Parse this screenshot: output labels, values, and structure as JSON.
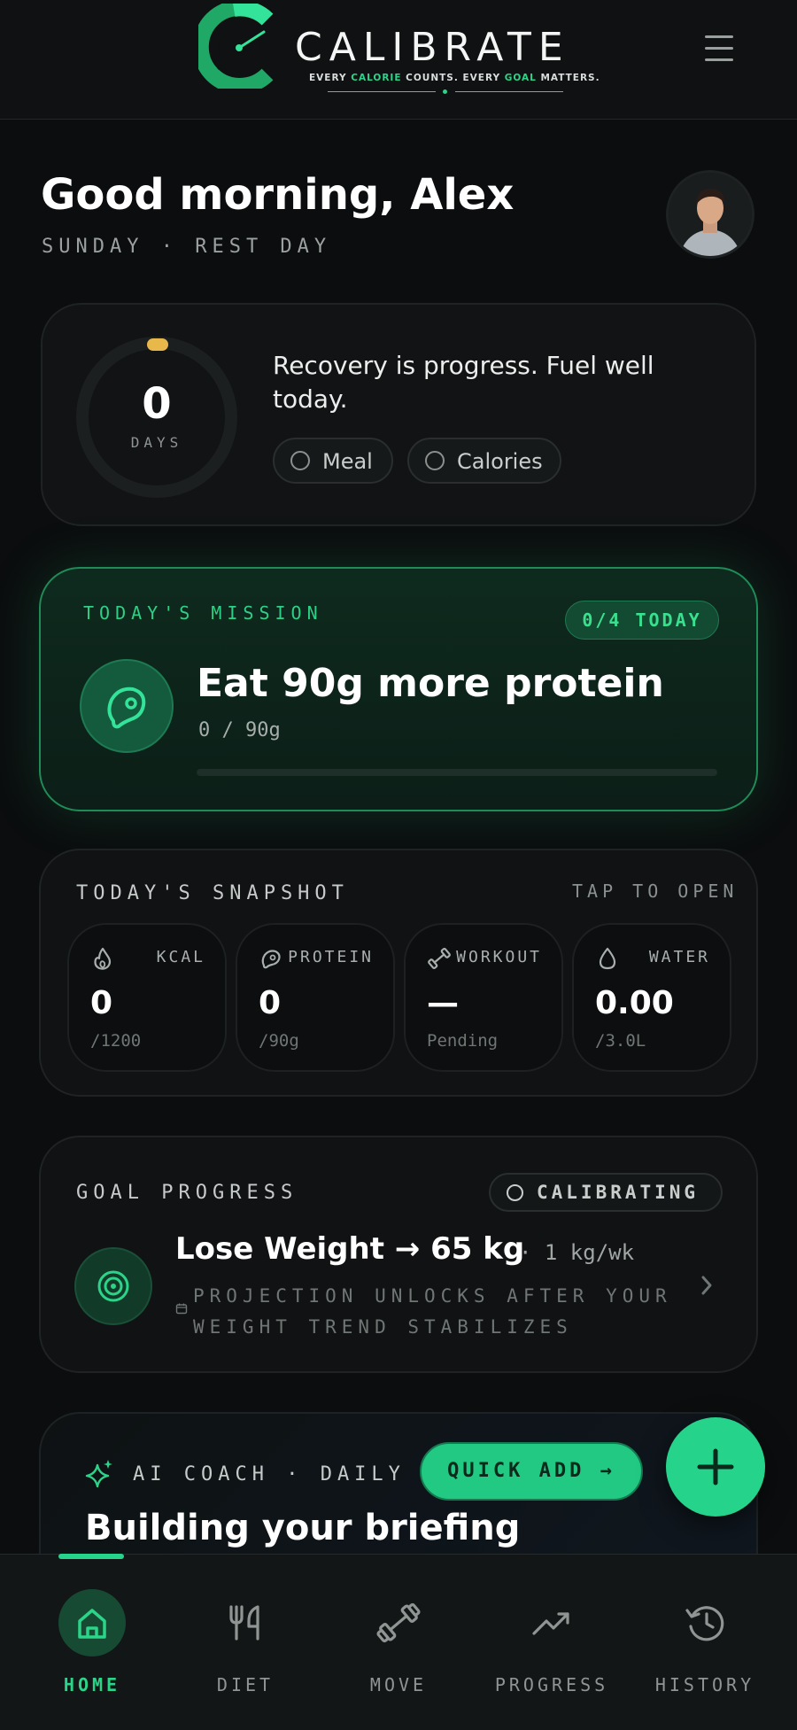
{
  "colors": {
    "accent": "#2bd488",
    "background": "#0b0d0e",
    "card": "#111314"
  },
  "header": {
    "brand": "CALIBRATE",
    "tagline_a": "EVERY ",
    "tagline_b": "CALORIE",
    "tagline_c": " COUNTS. EVERY ",
    "tagline_d": "GOAL",
    "tagline_e": " MATTERS.",
    "menu_icon": "hamburger-menu-icon"
  },
  "greeting": {
    "title": "Good morning, Alex",
    "subtitle": "SUNDAY · REST DAY",
    "avatar_icon": "user-avatar"
  },
  "streak": {
    "count": "0",
    "unit": "DAYS",
    "message": "Recovery is progress. Fuel well today.",
    "chips": [
      "Meal",
      "Calories"
    ]
  },
  "mission": {
    "label": "TODAY'S MISSION",
    "badge": "0/4 TODAY",
    "title": "Eat 90g more protein",
    "progress_text": "0 / 90g",
    "progress_fraction": 0,
    "icon": "steak-icon"
  },
  "snapshot": {
    "title": "TODAY'S SNAPSHOT",
    "action": "TAP TO OPEN",
    "tiles": [
      {
        "label": "KCAL",
        "value": "0",
        "sub": "/1200",
        "icon": "flame-icon"
      },
      {
        "label": "PROTEIN",
        "value": "0",
        "sub": "/90g",
        "icon": "steak-icon"
      },
      {
        "label": "WORKOUT",
        "value": "—",
        "sub": "Pending",
        "icon": "dumbbell-icon"
      },
      {
        "label": "WATER",
        "value": "0.00",
        "sub": "/3.0L",
        "icon": "droplet-icon"
      }
    ]
  },
  "goal": {
    "label": "GOAL PROGRESS",
    "badge": "CALIBRATING",
    "main": "Lose Weight → 65 kg",
    "rate": "· 1 kg/wk",
    "note": "PROJECTION UNLOCKS AFTER YOUR WEIGHT TREND STABILIZES",
    "icon": "target-icon"
  },
  "coach": {
    "label": "AI COACH · DAILY B",
    "title": "Building your briefing",
    "icon": "sparkle-icon"
  },
  "quick_add": {
    "label": "QUICK ADD →"
  },
  "fab": {
    "icon": "plus-icon"
  },
  "nav": {
    "items": [
      {
        "label": "HOME",
        "icon": "home-icon",
        "active": true
      },
      {
        "label": "DIET",
        "icon": "fork-knife-icon",
        "active": false
      },
      {
        "label": "MOVE",
        "icon": "dumbbell-icon",
        "active": false
      },
      {
        "label": "PROGRESS",
        "icon": "trending-up-icon",
        "active": false
      },
      {
        "label": "HISTORY",
        "icon": "history-icon",
        "active": false
      }
    ]
  }
}
